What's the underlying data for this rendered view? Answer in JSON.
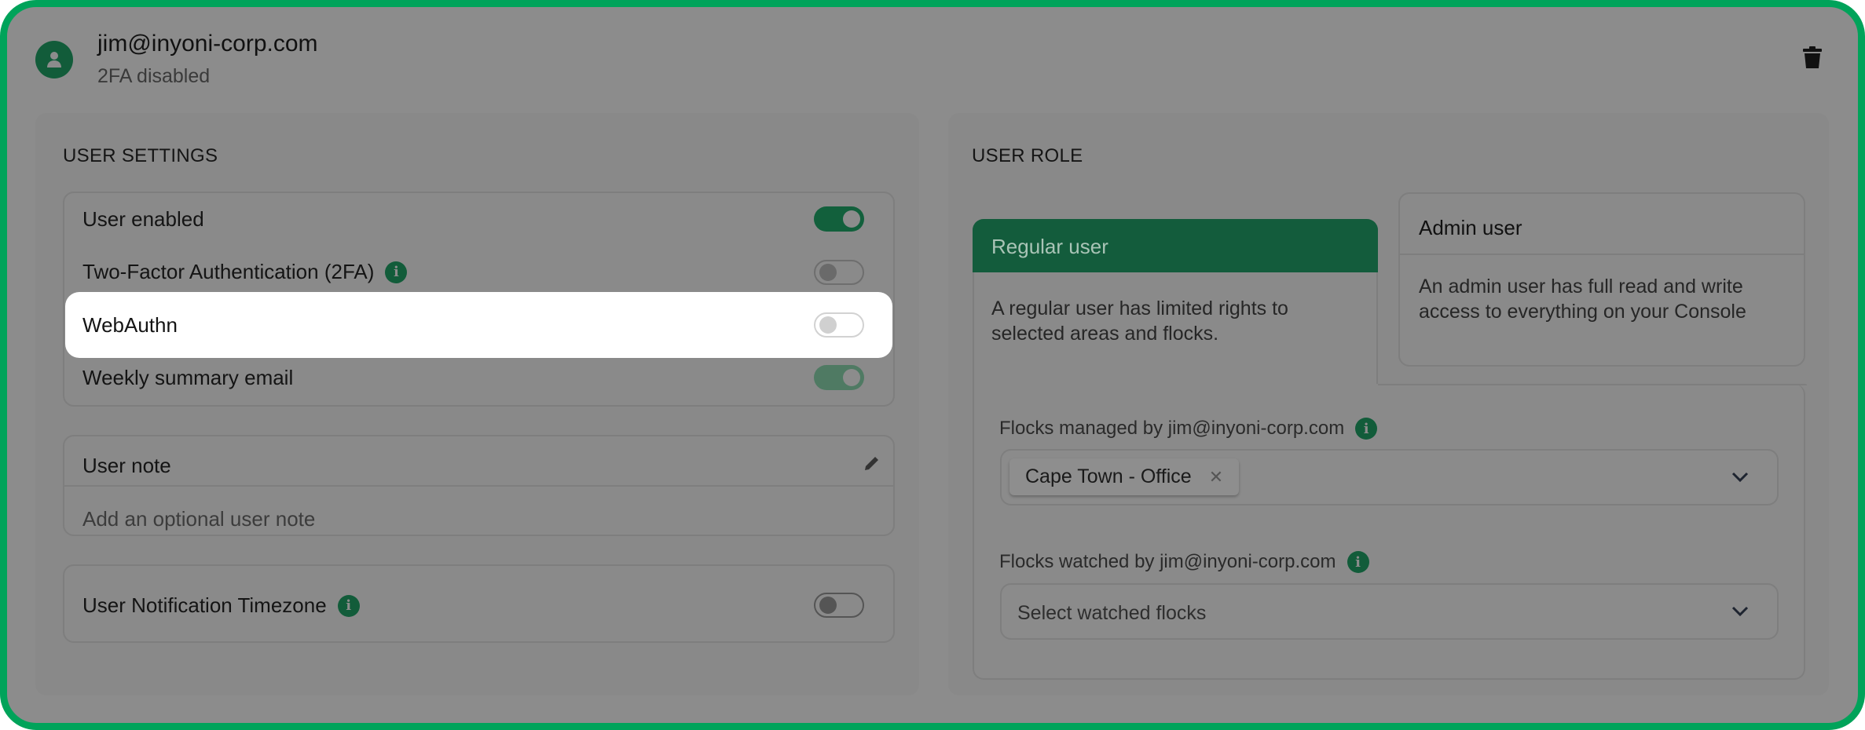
{
  "header": {
    "email": "jim@inyoni-corp.com",
    "status": "2FA disabled",
    "avatar_icon": "user-icon",
    "delete_icon": "trash-icon"
  },
  "user_settings": {
    "title": "USER SETTINGS",
    "toggles": [
      {
        "label": "User enabled",
        "on": true,
        "info": false
      },
      {
        "label": "Two-Factor Authentication (2FA)",
        "on": false,
        "info": true
      },
      {
        "label": "WebAuthn",
        "on": false,
        "info": false,
        "highlighted": true
      },
      {
        "label": "Weekly summary email",
        "on": true,
        "info": false
      }
    ],
    "note": {
      "title": "User note",
      "placeholder": "Add an optional user note",
      "edit_icon": "pencil-icon"
    },
    "timezone": {
      "label": "User Notification Timezone",
      "on": false
    }
  },
  "user_role": {
    "title": "USER ROLE",
    "regular": {
      "title": "Regular user",
      "description": "A regular user has limited rights to selected areas and flocks.",
      "selected": true
    },
    "admin": {
      "title": "Admin user",
      "description": "An admin user has full read and write access to everything on your Console",
      "selected": false
    },
    "managed": {
      "label": "Flocks managed by jim@inyoni-corp.com",
      "chips": [
        "Cape Town - Office"
      ]
    },
    "watched": {
      "label": "Flocks watched by jim@inyoni-corp.com",
      "placeholder": "Select watched flocks"
    }
  },
  "colors": {
    "accent": "#125c3a",
    "border": "#00a35a"
  }
}
